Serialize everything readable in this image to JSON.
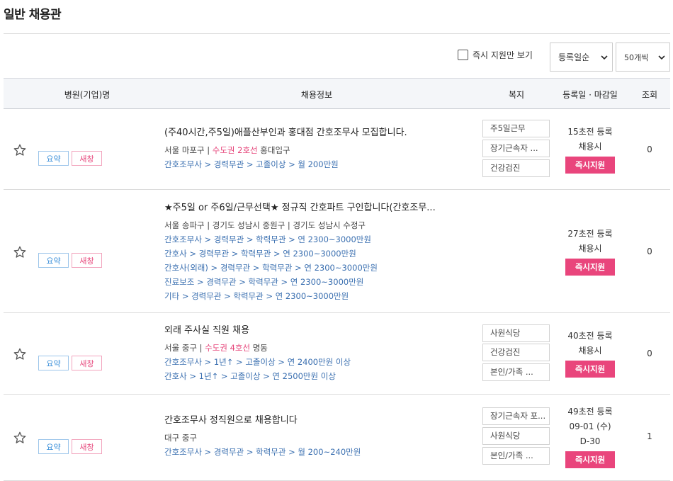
{
  "page": {
    "title": "일반 채용관"
  },
  "filters": {
    "instant_only_label": "즉시 지원만 보기",
    "sort_value": "등록일순",
    "count_value": "50개씩"
  },
  "table": {
    "headers": {
      "company": "병원(기업)명",
      "info": "채용정보",
      "benefits": "복지",
      "dates": "등록일 · 마감일",
      "views": "조회"
    },
    "summary_label": "요약",
    "new_window_label": "새창",
    "apply_label": "즉시지원"
  },
  "jobs": [
    {
      "title": "(주40시간,주5일)애플산부인과 홍대점 간호조무사 모집합니다.",
      "loc_prefix": "서울 마포구 | ",
      "loc_metro": "수도권 2호선",
      "loc_suffix": " 홍대입구",
      "categories": [
        "간호조무사 > 경력무관 > 고졸이상 > 월 200만원"
      ],
      "benefits": [
        "주5일근무",
        "장기근속자 ...",
        "건강검진"
      ],
      "posted": "15초전 등록",
      "deadline": "채용시",
      "deadline2": "",
      "views": "0"
    },
    {
      "title": "★주5일 or 주6일/근무선택★ 정규직 간호파트 구인합니다(간호조무...",
      "loc_prefix": "서울 송파구 | 경기도 성남시 중원구 | 경기도 성남시 수정구",
      "loc_metro": "",
      "loc_suffix": "",
      "categories": [
        "간호조무사 > 경력무관 > 학력무관 > 연 2300~3000만원",
        "간호사 > 경력무관 > 학력무관 > 연 2300~3000만원",
        "간호사(외래) > 경력무관 > 학력무관 > 연 2300~3000만원",
        "진료보조 > 경력무관 > 학력무관 > 연 2300~3000만원",
        "기타 > 경력무관 > 학력무관 > 연 2300~3000만원"
      ],
      "benefits": [],
      "posted": "27초전 등록",
      "deadline": "채용시",
      "deadline2": "",
      "views": "0"
    },
    {
      "title": "외래 주사실 직원 채용",
      "loc_prefix": "서울 중구 | ",
      "loc_metro": "수도권 4호선",
      "loc_suffix": " 명동",
      "categories": [
        "간호조무사 > 1년↑ > 고졸이상 > 연 2400만원 이상",
        "간호사 > 1년↑ > 고졸이상 > 연 2500만원 이상"
      ],
      "benefits": [
        "사원식당",
        "건강검진",
        "본인/가족 ..."
      ],
      "posted": "40초전 등록",
      "deadline": "채용시",
      "deadline2": "",
      "views": "0"
    },
    {
      "title": "간호조무사 정직원으로 채용합니다",
      "loc_prefix": "대구 중구",
      "loc_metro": "",
      "loc_suffix": "",
      "categories": [
        "간호조무사 > 경력무관 > 학력무관 > 월 200~240만원"
      ],
      "benefits": [
        "장기근속자 포...",
        "사원식당",
        "본인/가족 ..."
      ],
      "posted": "49초전 등록",
      "deadline": "09-01 (수)",
      "deadline2": "D-30",
      "views": "1"
    }
  ]
}
